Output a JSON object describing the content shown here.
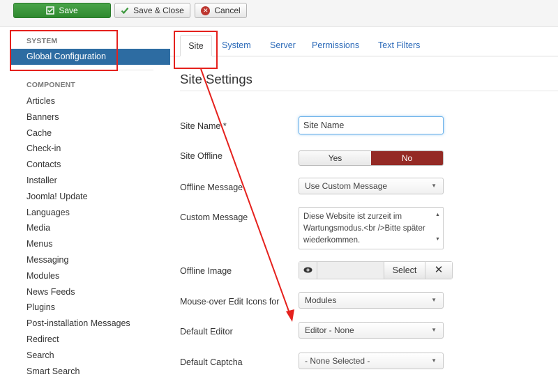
{
  "toolbar": {
    "save_label": "Save",
    "save_close_label": "Save & Close",
    "cancel_label": "Cancel"
  },
  "sidebar": {
    "system_heading": "SYSTEM",
    "active_item": "Global Configuration",
    "component_heading": "COMPONENT",
    "items": [
      "Articles",
      "Banners",
      "Cache",
      "Check-in",
      "Contacts",
      "Installer",
      "Joomla! Update",
      "Languages",
      "Media",
      "Menus",
      "Messaging",
      "Modules",
      "News Feeds",
      "Plugins",
      "Post-installation Messages",
      "Redirect",
      "Search",
      "Smart Search"
    ]
  },
  "tabs": [
    "Site",
    "System",
    "Server",
    "Permissions",
    "Text Filters"
  ],
  "section_title": "Site Settings",
  "form": {
    "site_name": {
      "label": "Site Name *",
      "value": "Site Name"
    },
    "site_offline": {
      "label": "Site Offline",
      "yes": "Yes",
      "no": "No"
    },
    "offline_message": {
      "label": "Offline Message",
      "value": "Use Custom Message"
    },
    "custom_message": {
      "label": "Custom Message",
      "value": "Diese Website ist zurzeit im Wartungsmodus.<br />Bitte später wiederkommen."
    },
    "offline_image": {
      "label": "Offline Image",
      "select_label": "Select"
    },
    "mouseover_icons": {
      "label": "Mouse-over Edit Icons for",
      "value": "Modules"
    },
    "default_editor": {
      "label": "Default Editor",
      "value": "Editor - None"
    },
    "default_captcha": {
      "label": "Default Captcha",
      "value": "- None Selected -"
    }
  },
  "colors": {
    "save_green": "#3b973b",
    "active_blue": "#2d6ca2",
    "no_red": "#942a25",
    "annotation_red": "#e5211d",
    "link_blue": "#2a69b8"
  }
}
